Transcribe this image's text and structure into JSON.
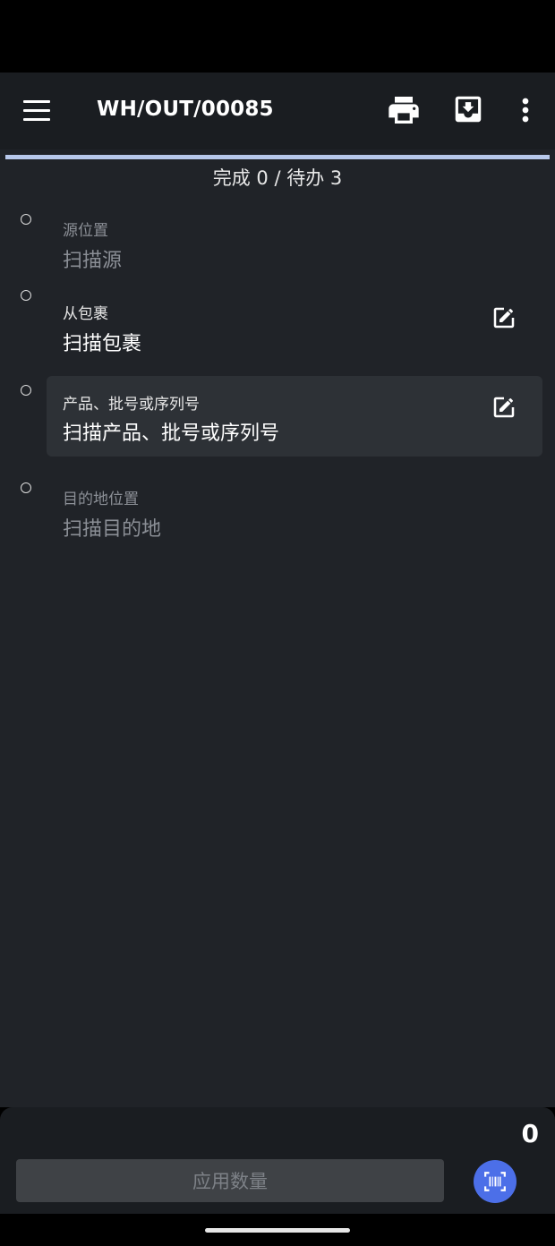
{
  "header": {
    "title": "WH/OUT/00085",
    "icons": [
      "menu-icon",
      "printer-icon",
      "download-icon",
      "more-vertical-icon"
    ]
  },
  "progress": {
    "fraction": 1.0
  },
  "summary": "完成 0 / 待办 3",
  "steps": [
    {
      "label": "源位置",
      "value": "扫描源",
      "state": "muted"
    },
    {
      "label": "从包裹",
      "value": "扫描包裹",
      "state": "active",
      "editable": true
    },
    {
      "label": "产品、批号或序列号",
      "value": "扫描产品、批号或序列号",
      "state": "active",
      "editable": true,
      "selected": true
    },
    {
      "label": "目的地位置",
      "value": "扫描目的地",
      "state": "muted"
    }
  ],
  "footer": {
    "quantity": "0",
    "apply_label": "应用数量",
    "scan_icon": "barcode-scan-icon"
  },
  "colors": {
    "background": "#202328",
    "appbar": "#1a1d21",
    "selected_row": "#2d3136",
    "accent": "#4c6fe8",
    "progress": "#b8c9ec"
  }
}
